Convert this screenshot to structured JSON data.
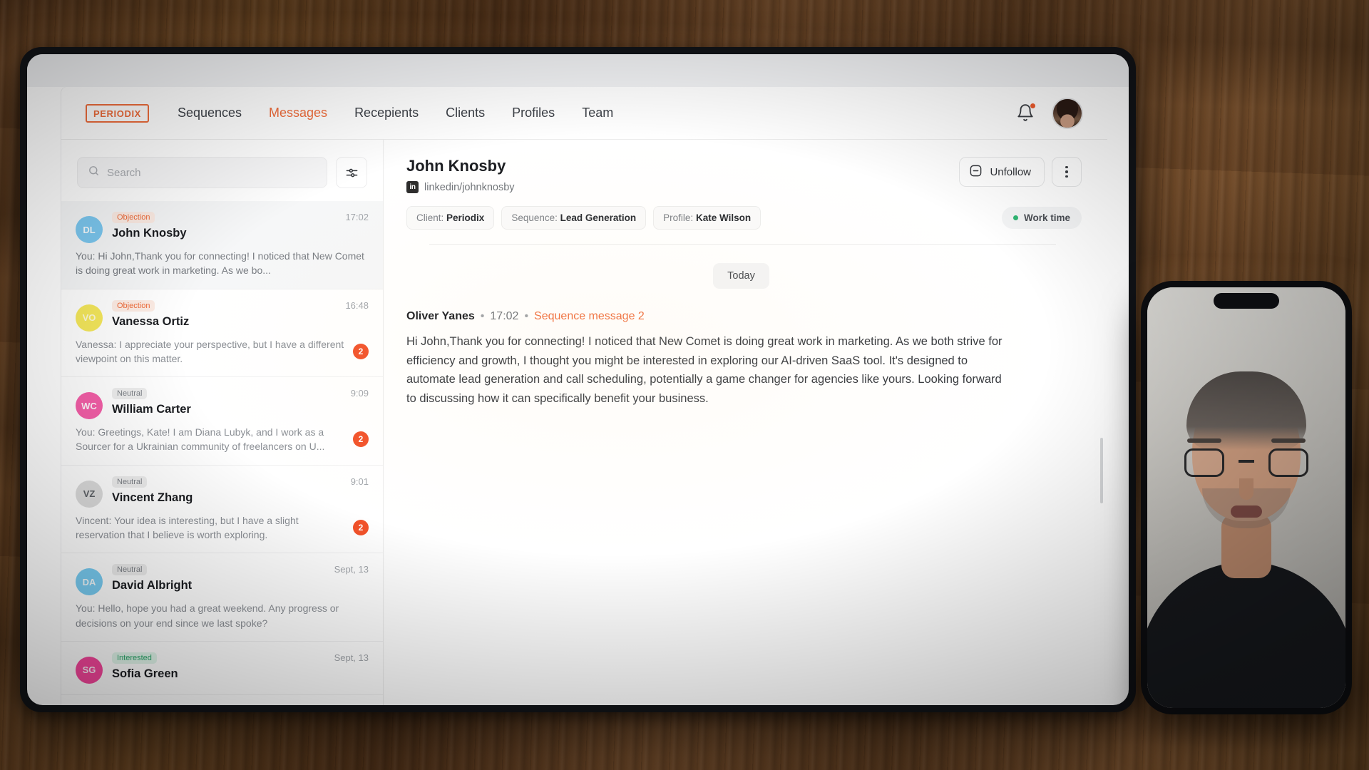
{
  "nav": {
    "logo": "PERIODIX",
    "links": [
      {
        "label": "Sequences",
        "active": false
      },
      {
        "label": "Messages",
        "active": true
      },
      {
        "label": "Recepients",
        "active": false
      },
      {
        "label": "Clients",
        "active": false
      },
      {
        "label": "Profiles",
        "active": false
      },
      {
        "label": "Team",
        "active": false
      }
    ],
    "bell_icon": "bell-icon",
    "has_notification": true,
    "avatar_icon": "user-avatar"
  },
  "search": {
    "placeholder": "Search",
    "value": "",
    "icon": "search-icon",
    "filter_icon": "filter-sliders-icon"
  },
  "conversations": [
    {
      "initials": "DL",
      "avatar_color": "#7cc8f0",
      "tag": "Objection",
      "tag_type": "objection",
      "name": "John Knosby",
      "time": "17:02",
      "preview": "You: Hi John,Thank you for connecting! I noticed that New Comet is doing great work in marketing. As we bo...",
      "unread": "",
      "selected": true
    },
    {
      "initials": "VO",
      "avatar_color": "#f5e85c",
      "tag": "Objection",
      "tag_type": "objection",
      "name": "Vanessa Ortiz",
      "time": "16:48",
      "preview": "Vanessa: I appreciate your perspective, but I have a different viewpoint on this matter.",
      "unread": "2",
      "selected": false
    },
    {
      "initials": "WC",
      "avatar_color": "#f45fa8",
      "tag": "Neutral",
      "tag_type": "neutral",
      "name": "William Carter",
      "time": "9:09",
      "preview": "You: Greetings, Kate! I am Diana Lubyk, and I work as a Sourcer for a Ukrainian community of freelancers on U...",
      "unread": "2",
      "selected": false
    },
    {
      "initials": "VZ",
      "avatar_color": "#dcdcdc",
      "tag": "Neutral",
      "tag_type": "neutral",
      "name": "Vincent Zhang",
      "time": "9:01",
      "preview": "Vincent: Your idea is interesting, but I have a slight reservation that I believe is worth exploring.",
      "unread": "2",
      "selected": false
    },
    {
      "initials": "DA",
      "avatar_color": "#79cdf3",
      "tag": "Neutral",
      "tag_type": "neutral",
      "name": "David Albright",
      "time": "Sept, 13",
      "preview": "You: Hello, hope you had a great weekend. Any progress or decisions on your end since we last spoke?",
      "unread": "",
      "selected": false
    },
    {
      "initials": "SG",
      "avatar_color": "#f7469c",
      "tag": "Interested",
      "tag_type": "interested",
      "name": "Sofia Green",
      "time": "Sept, 13",
      "preview": "",
      "unread": "",
      "selected": false
    }
  ],
  "thread": {
    "contact_name": "John Knosby",
    "linkedin_badge": "in",
    "linkedin_handle": "linkedin/johnknosby",
    "unfollow_label": "Unfollow",
    "unfollow_icon": "minus-square-icon",
    "kebab_icon": "more-vertical-icon",
    "chips": [
      {
        "label": "Client:",
        "value": "Periodix"
      },
      {
        "label": "Sequence:",
        "value": "Lead Generation"
      },
      {
        "label": "Profile:",
        "value": "Kate Wilson"
      }
    ],
    "work_time_label": "Work time",
    "work_time_color": "#2fb673",
    "date_divider": "Today",
    "message": {
      "author": "Oliver Yanes",
      "time": "17:02",
      "sequence_label": "Sequence message 2",
      "body": "Hi John,Thank you for connecting! I noticed that New Comet is doing great work in marketing. As we both strive for efficiency and growth, I thought you might be interested in exploring our AI-driven SaaS tool. It's designed to automate lead generation and call scheduling, potentially a game changer for agencies like yours. Looking forward to discussing how it can specifically benefit your business."
    }
  },
  "theme": {
    "accent": "#ef6c3b",
    "unread_badge": "#f2522a",
    "text_primary": "#1b1d21",
    "text_muted": "#8b8f95"
  }
}
